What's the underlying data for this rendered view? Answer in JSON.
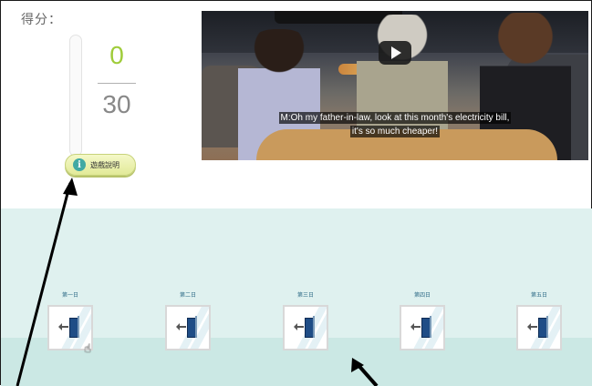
{
  "score": {
    "label": "得分：",
    "current": "0",
    "total": "30",
    "fraction": 0
  },
  "help_button": {
    "icon": "info-icon",
    "label": "遊戲說明"
  },
  "video": {
    "subtitle_line1": "M:Oh my father-in-law, look at this month's electricity bill,",
    "subtitle_line2": "it's so much cheaper!",
    "play_icon": "youtube-play-icon"
  },
  "days": [
    {
      "label": "第一日",
      "icon": "door-exit-icon"
    },
    {
      "label": "第二日",
      "icon": "door-exit-icon"
    },
    {
      "label": "第三日",
      "icon": "door-exit-icon"
    },
    {
      "label": "第四日",
      "icon": "door-exit-icon"
    },
    {
      "label": "第五日",
      "icon": "door-exit-icon"
    }
  ],
  "colors": {
    "score_current": "#9fcc3a",
    "help_button": "#e2ea98",
    "info_icon": "#41a9a3",
    "lower_background": "#dff1ef",
    "door": "#1f4d86"
  }
}
